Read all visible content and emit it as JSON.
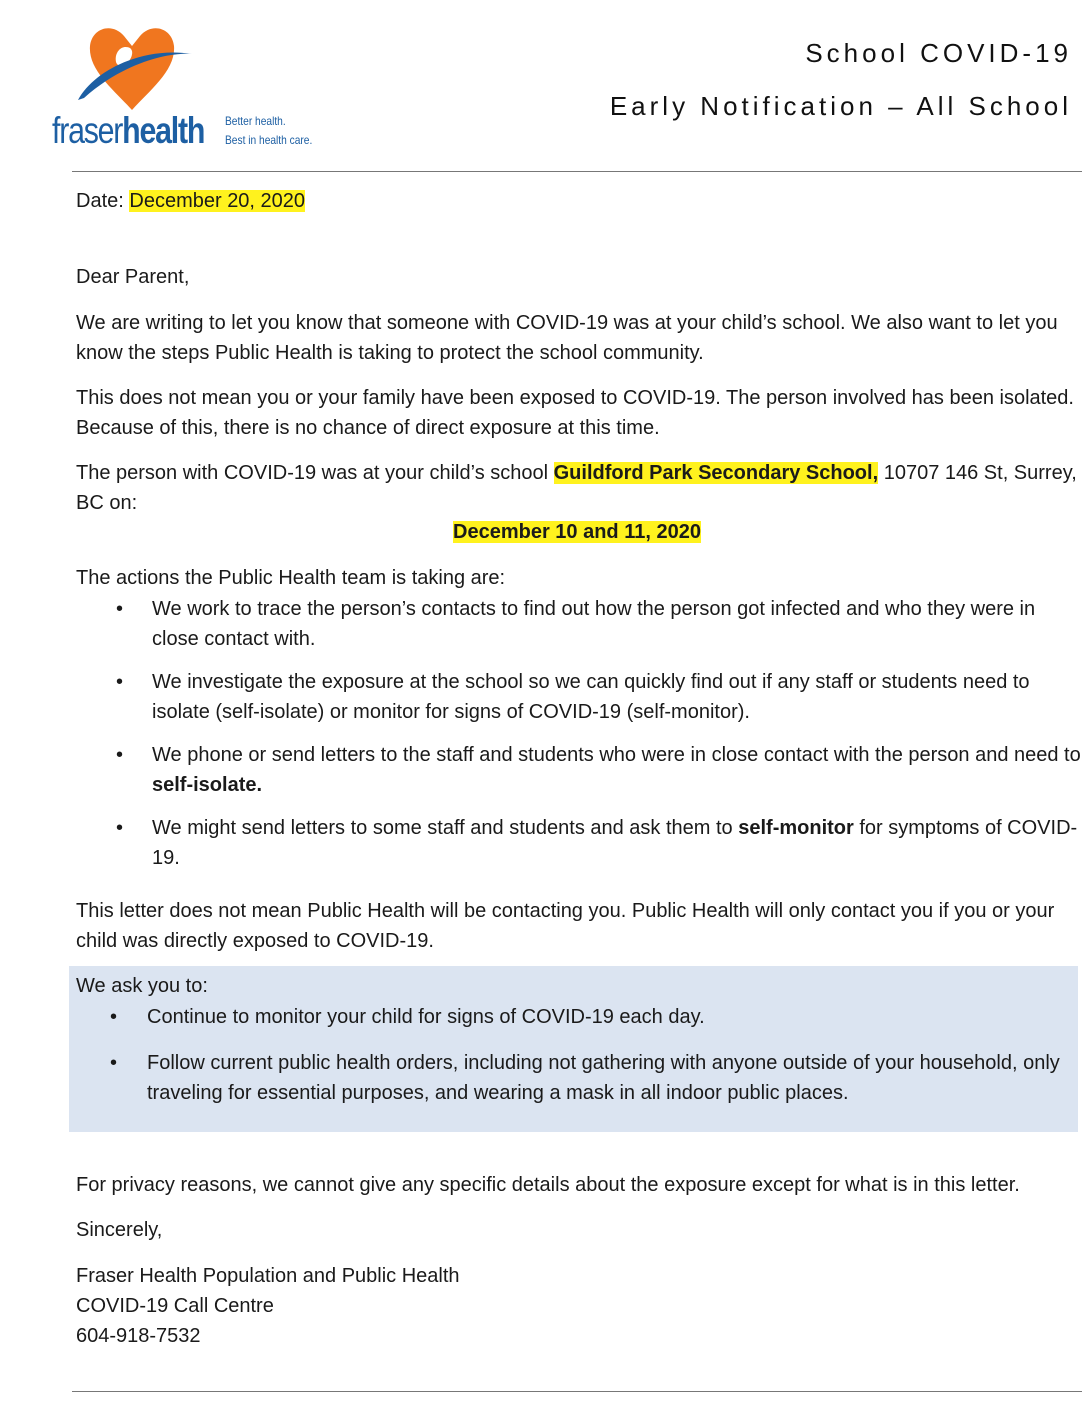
{
  "brand": {
    "name_light": "fraser",
    "name_bold": "health",
    "tagline_1": "Better health.",
    "tagline_2": "Best in health care.",
    "colors": {
      "blue": "#1d5fa3",
      "orange": "#f0761f"
    }
  },
  "header": {
    "title_line1": "School COVID-19",
    "title_line2": "Early Notification – All School"
  },
  "letter": {
    "date_label": "Date:",
    "date_value": "December 20, 2020",
    "greeting": "Dear Parent,",
    "p1": "We are writing to let you know that someone with COVID-19 was at your child’s school. We also want to let you know the steps Public Health is taking to protect the school community.",
    "p2": "This does not mean you or your family have been exposed to COVID-19. The person involved has been isolated. Because of this, there is no chance of direct exposure at this time.",
    "p3_prefix": "The person with COVID-19 was at your child’s school ",
    "school_name": "Guildford Park Secondary School,",
    "p3_suffix": " 10707 146 St, Surrey, BC on:",
    "exposure_dates": "December 10 and 11, 2020",
    "actions_intro": "The actions the Public Health team is taking are:",
    "actions": [
      {
        "text": "We work to trace the person’s contacts to find out how the person got infected and who they were in close contact with.",
        "bold": "",
        "after": ""
      },
      {
        "text": "We investigate the exposure at the school so we can quickly find out if any staff or students need to isolate (self-isolate) or monitor for signs of COVID-19 (self-monitor).",
        "bold": "",
        "after": ""
      },
      {
        "text": "We phone or send letters to the staff and students who were in close contact with the person and need to ",
        "bold": "self-isolate.",
        "after": ""
      },
      {
        "text": "We might send letters to some staff and students and ask them to ",
        "bold": "self-monitor",
        "after": " for symptoms of COVID-19."
      }
    ],
    "p4": "This letter does not mean Public Health will be contacting you. Public Health will only contact you if you or your child was directly exposed to COVID-19.",
    "ask_title": "We ask you to:",
    "asks": [
      "Continue to monitor your child for signs of COVID-19 each day.",
      "Follow current public health orders, including not gathering with anyone outside of your household, only traveling for essential purposes, and wearing a mask in all indoor public places."
    ],
    "privacy": "For privacy reasons, we cannot give any specific details about the exposure except for what is in this letter.",
    "closing": "Sincerely,",
    "signature": [
      "Fraser Health Population and Public Health",
      "COVID-19 Call Centre",
      "604-918-7532"
    ],
    "bullet": "•"
  }
}
